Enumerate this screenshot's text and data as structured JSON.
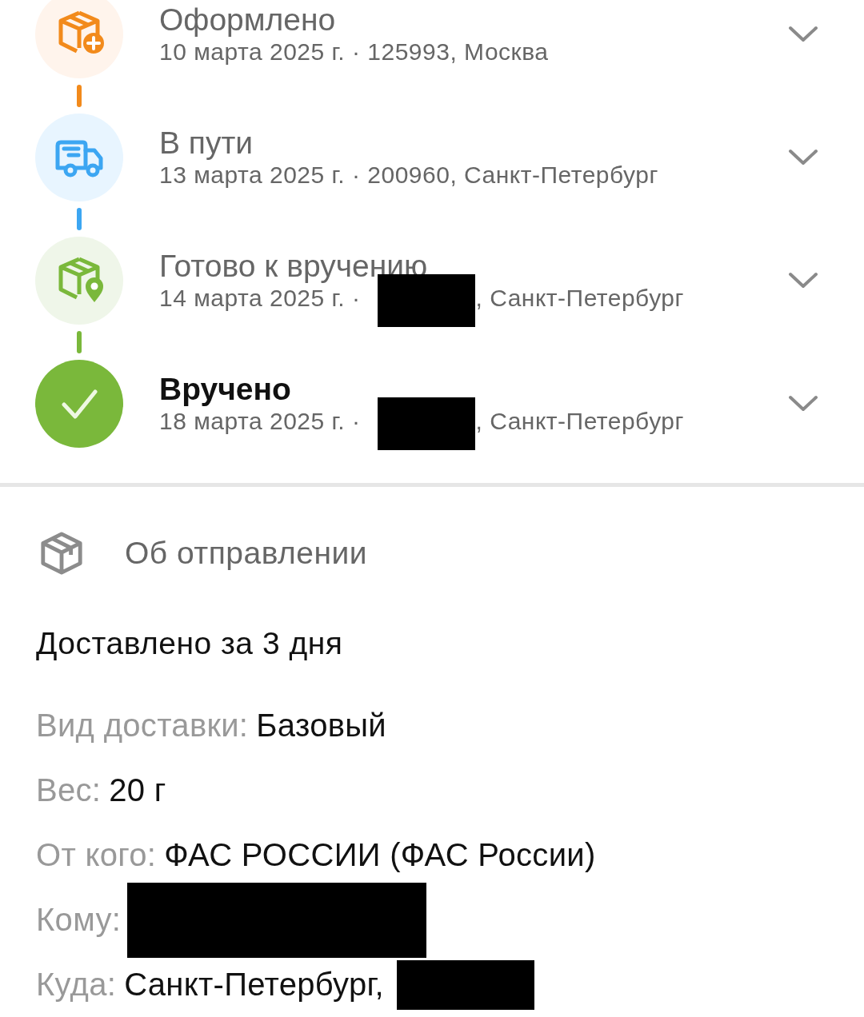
{
  "events": [
    {
      "kind": "created",
      "title": "Оформлено",
      "date": "10 марта 2025 г. · 125993, Москва",
      "redacted": false,
      "color": "#f28a1b",
      "expanded": false
    },
    {
      "kind": "transit",
      "title": "В пути",
      "date": "13 марта 2025 г. · 200960, Санкт-Петербург",
      "redacted": false,
      "color": "#3ca6f2",
      "expanded": false
    },
    {
      "kind": "ready",
      "title": "Готово к вручению",
      "date": "14 марта 2025 г. ·",
      "redacted": true,
      "place": ", Санкт-Петербург",
      "color": "#7ab83b",
      "expanded": false
    },
    {
      "kind": "delivered",
      "title": "Вручено",
      "date": "18 марта 2025 г. ·",
      "redacted": true,
      "place": ", Санкт-Петербург",
      "color": "#7ab83b",
      "expanded": false
    }
  ],
  "section": {
    "title": "Об отправлении"
  },
  "summary": "Доставлено за 3 дня",
  "details": [
    {
      "label": "Вид доставки:",
      "value": "Базовый",
      "redacted": false
    },
    {
      "label": "Вес:",
      "value": "20 г",
      "redacted": false
    },
    {
      "label": "От кого:",
      "value": "ФАС РОССИИ (ФАС России)",
      "redacted": false
    },
    {
      "label": "Кому:",
      "redacted": true
    },
    {
      "label": "Куда:",
      "value": "Санкт-Петербург,",
      "redacted": true
    }
  ]
}
